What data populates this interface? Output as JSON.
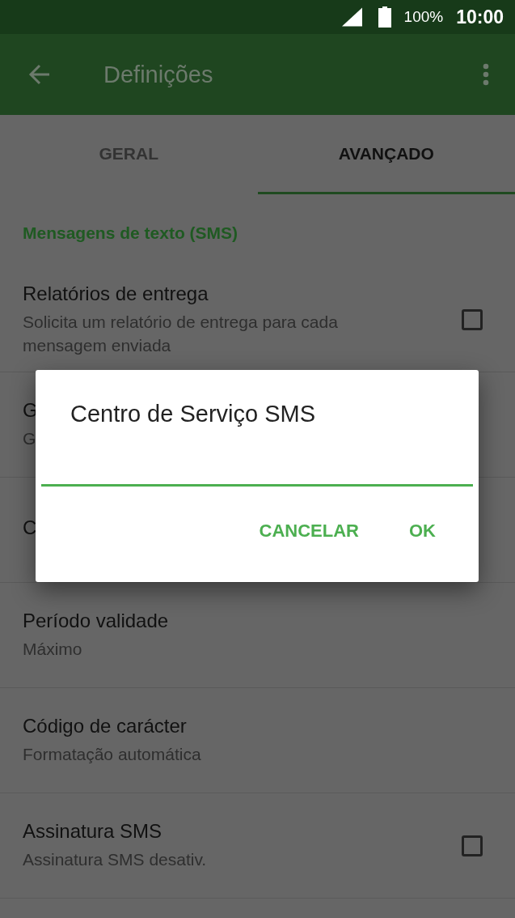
{
  "status_bar": {
    "battery": "100%",
    "time": "10:00"
  },
  "toolbar": {
    "title": "Definições"
  },
  "tabs": [
    {
      "label": "GERAL",
      "selected": false
    },
    {
      "label": "AVANÇADO",
      "selected": true
    }
  ],
  "section": {
    "title": "Mensagens de texto (SMS)",
    "items": [
      {
        "kind": "checkbox",
        "title": "Relatórios de entrega",
        "subtitle": "Solicita um relatório de entrega para cada mensagem enviada",
        "checked": false
      },
      {
        "kind": "text",
        "title": "G",
        "subtitle": "G"
      },
      {
        "kind": "text",
        "title": "C"
      },
      {
        "kind": "text",
        "title": "Período validade",
        "subtitle": "Máximo"
      },
      {
        "kind": "text",
        "title": "Código de carácter",
        "subtitle": "Formatação automática"
      },
      {
        "kind": "checkbox",
        "title": "Assinatura SMS",
        "subtitle": "Assinatura SMS desativ.",
        "checked": false
      }
    ]
  },
  "dialog": {
    "title": "Centro de Serviço SMS",
    "buttons": [
      "CANCELAR",
      "OK"
    ]
  }
}
